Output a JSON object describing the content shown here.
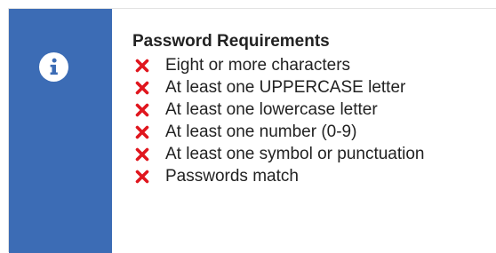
{
  "panel": {
    "icon": "info-icon",
    "accent_color": "#3c6cb5",
    "title": "Password Requirements",
    "status_color": "#e0161e",
    "requirements": [
      {
        "label": "Eight or more characters",
        "status": "unmet",
        "icon": "x-icon"
      },
      {
        "label": "At least one UPPERCASE letter",
        "status": "unmet",
        "icon": "x-icon"
      },
      {
        "label": "At least one lowercase letter",
        "status": "unmet",
        "icon": "x-icon"
      },
      {
        "label": "At least one number (0-9)",
        "status": "unmet",
        "icon": "x-icon"
      },
      {
        "label": "At least one symbol or punctuation",
        "status": "unmet",
        "icon": "x-icon"
      },
      {
        "label": "Passwords match",
        "status": "unmet",
        "icon": "x-icon"
      }
    ]
  }
}
